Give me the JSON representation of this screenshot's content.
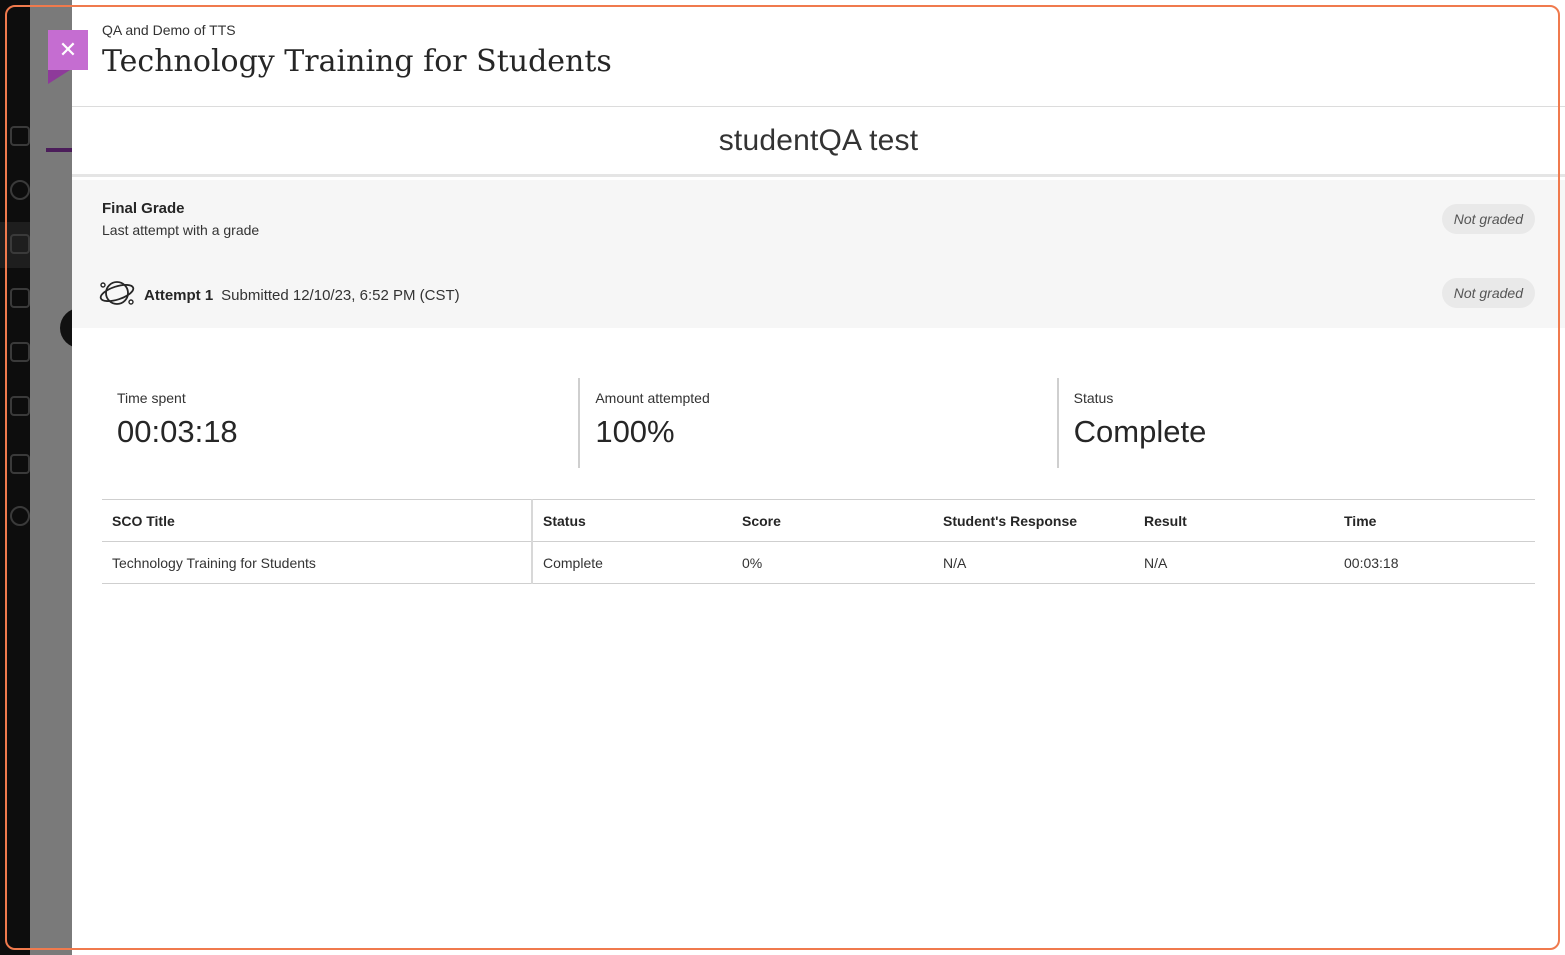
{
  "header": {
    "course_name": "QA and Demo of TTS",
    "title": "Technology Training for Students"
  },
  "close_button": {
    "icon": "close-icon",
    "glyph": "✕"
  },
  "student": {
    "name": "studentQA test"
  },
  "final_grade": {
    "label": "Final Grade",
    "sublabel": "Last attempt with a grade",
    "value": "Not graded"
  },
  "attempt": {
    "icon": "planet-icon",
    "label": "Attempt 1",
    "submitted": "Submitted 12/10/23, 6:52 PM (CST)",
    "grade": "Not graded"
  },
  "stats": [
    {
      "label": "Time spent",
      "value": "00:03:18"
    },
    {
      "label": "Amount attempted",
      "value": "100%"
    },
    {
      "label": "Status",
      "value": "Complete"
    }
  ],
  "table": {
    "headers": [
      "SCO Title",
      "Status",
      "Score",
      "Student's Response",
      "Result",
      "Time"
    ],
    "rows": [
      [
        "Technology Training for Students",
        "Complete",
        "0%",
        "N/A",
        "N/A",
        "00:03:18"
      ]
    ]
  },
  "colors": {
    "close_bg": "#c56dd1",
    "focus_outline": "#f07a4d",
    "accent_purple": "#4b1d5a"
  }
}
